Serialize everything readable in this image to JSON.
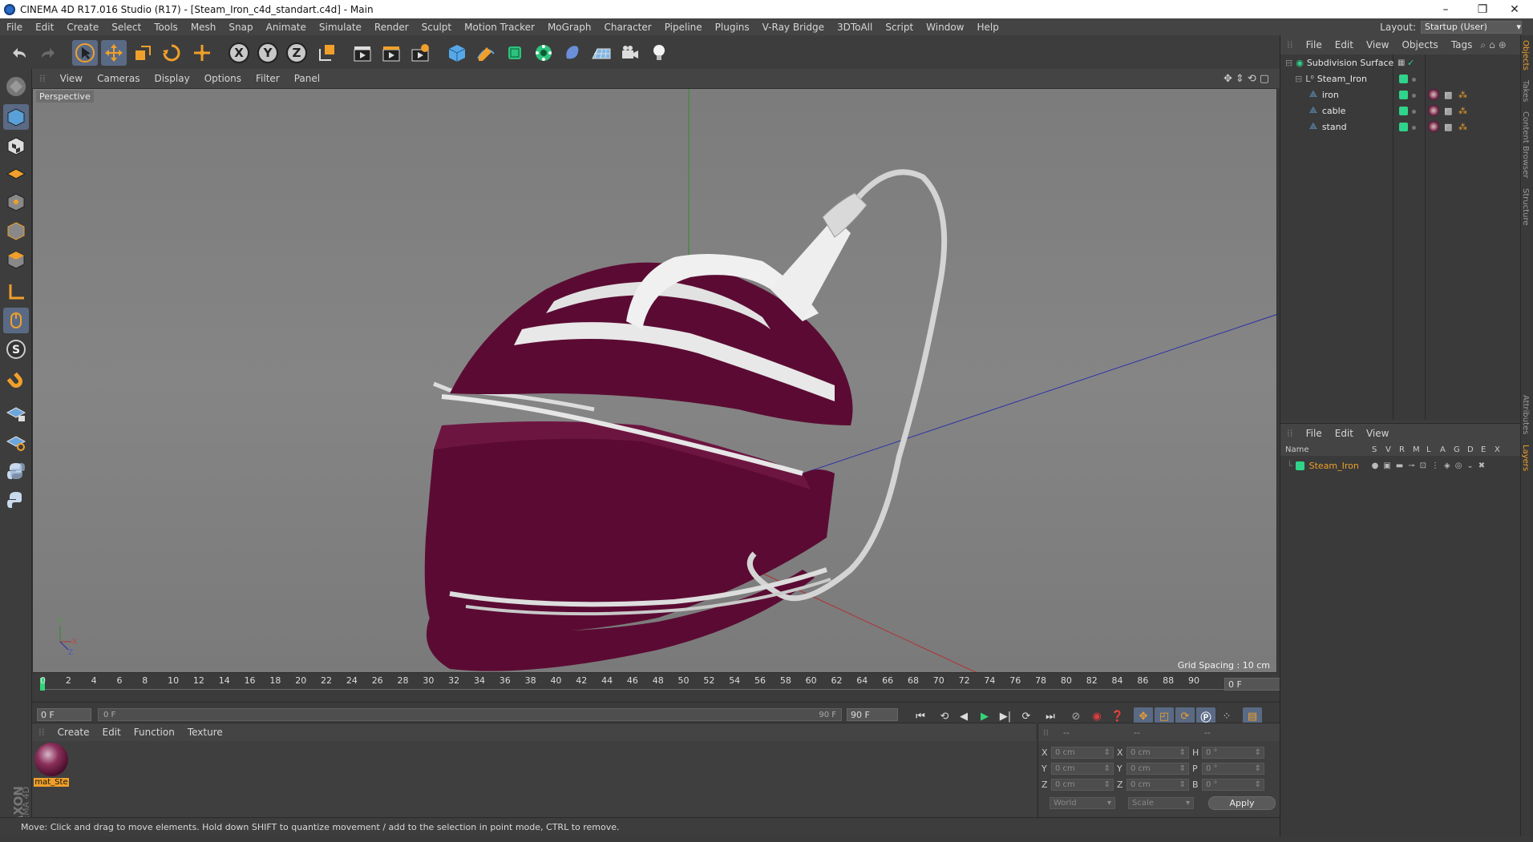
{
  "window": {
    "title": "CINEMA 4D R17.016 Studio (R17) - [Steam_Iron_c4d_standart.c4d] - Main",
    "controls": [
      "–",
      "❐",
      "✕"
    ]
  },
  "menubar": [
    "File",
    "Edit",
    "Create",
    "Select",
    "Tools",
    "Mesh",
    "Snap",
    "Animate",
    "Simulate",
    "Render",
    "Sculpt",
    "Motion Tracker",
    "MoGraph",
    "Character",
    "Pipeline",
    "Plugins",
    "V-Ray Bridge",
    "3DToAll",
    "Script",
    "Window",
    "Help"
  ],
  "layout": {
    "label": "Layout:",
    "value": "Startup (User)"
  },
  "viewport": {
    "menu": [
      "View",
      "Cameras",
      "Display",
      "Options",
      "Filter",
      "Panel"
    ],
    "label": "Perspective",
    "grid_spacing": "Grid Spacing : 10 cm"
  },
  "timeline": {
    "ticks": [
      "0",
      "2",
      "4",
      "6",
      "8",
      "10",
      "12",
      "14",
      "16",
      "18",
      "20",
      "22",
      "24",
      "26",
      "28",
      "30",
      "32",
      "34",
      "36",
      "38",
      "40",
      "42",
      "44",
      "46",
      "48",
      "50",
      "52",
      "54",
      "56",
      "58",
      "60",
      "62",
      "64",
      "66",
      "68",
      "70",
      "72",
      "74",
      "76",
      "78",
      "80",
      "82",
      "84",
      "86",
      "88",
      "90"
    ],
    "current_frame": "0 F",
    "start_field": "0 F",
    "range_start": "0 F",
    "range_end": "90 F",
    "end_field": "90 F"
  },
  "material_panel": {
    "menu": [
      "Create",
      "Edit",
      "Function",
      "Texture"
    ],
    "materials": [
      {
        "name": "mat_Ste"
      }
    ]
  },
  "coords": {
    "headers": [
      "--",
      "--",
      "--"
    ],
    "rows": [
      {
        "a": "X",
        "av": "0 cm",
        "b": "X",
        "bv": "0 cm",
        "c": "H",
        "cv": "0 °"
      },
      {
        "a": "Y",
        "av": "0 cm",
        "b": "Y",
        "bv": "0 cm",
        "c": "P",
        "cv": "0 °"
      },
      {
        "a": "Z",
        "av": "0 cm",
        "b": "Z",
        "bv": "0 cm",
        "c": "B",
        "cv": "0 °"
      }
    ],
    "world": "World",
    "scale": "Scale",
    "apply": "Apply"
  },
  "status": "Move: Click and drag to move elements. Hold down SHIFT to quantize movement / add to the selection in point mode, CTRL to remove.",
  "object_manager": {
    "menu": [
      "File",
      "Edit",
      "View",
      "Objects",
      "Tags"
    ],
    "objects": [
      {
        "name": "Subdivision Surface"
      },
      {
        "name": "Steam_Iron"
      },
      {
        "name": "iron"
      },
      {
        "name": "cable"
      },
      {
        "name": "stand"
      }
    ]
  },
  "layer_manager": {
    "menu": [
      "File",
      "Edit",
      "View"
    ],
    "columns": [
      "Name",
      "S",
      "V",
      "R",
      "M",
      "L",
      "A",
      "G",
      "D",
      "E",
      "X"
    ],
    "layers": [
      {
        "name": "Steam_Iron"
      }
    ]
  },
  "side_tabs": [
    "Objects",
    "Takes",
    "Content Browser",
    "Structure"
  ],
  "side_tabs_lower": [
    "Attributes",
    "Layers"
  ],
  "brand": "MAXON CINEMA 4D",
  "colors": {
    "accent": "#f0a02a",
    "maroon": "#5b0b33",
    "layer_green": "#2fd38a"
  }
}
